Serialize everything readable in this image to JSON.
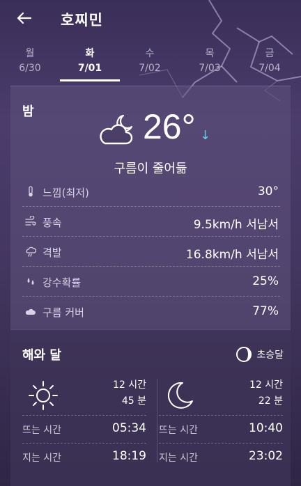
{
  "header": {
    "city": "호찌민",
    "back_icon": "back-arrow-icon"
  },
  "tabs": [
    {
      "dow": "월",
      "date": "6/30",
      "active": false
    },
    {
      "dow": "화",
      "date": "7/01",
      "active": true
    },
    {
      "dow": "수",
      "date": "7/02",
      "active": false
    },
    {
      "dow": "목",
      "date": "7/03",
      "active": false
    },
    {
      "dow": "금",
      "date": "7/04",
      "active": false
    }
  ],
  "detail": {
    "period": "밤",
    "condition_icon": "partly-cloudy-night-icon",
    "temperature": "26°",
    "trend": "↓",
    "condition": "구름이 줄어듦",
    "rows": [
      {
        "icon": "thermometer-icon",
        "label": "느낌(최저)",
        "value": "30°"
      },
      {
        "icon": "wind-icon",
        "label": "풍속",
        "value": "9.5km/h 서남서"
      },
      {
        "icon": "gust-icon",
        "label": "격발",
        "value": "16.8km/h 서남서"
      },
      {
        "icon": "rain-drops-icon",
        "label": "강수확률",
        "value": "25%"
      },
      {
        "icon": "cloud-icon",
        "label": "구름 커버",
        "value": "77%"
      }
    ]
  },
  "sun_moon": {
    "title": "해와 달",
    "moon_phase": "초승달",
    "sun": {
      "duration_hours": "12 시간",
      "duration_minutes": "45 분",
      "rise_label": "뜨는 시간",
      "rise_time": "05:34",
      "set_label": "지는 시간",
      "set_time": "18:19"
    },
    "moon": {
      "duration_hours": "12 시간",
      "duration_minutes": "22 분",
      "rise_label": "뜨는 시간",
      "rise_time": "10:40",
      "set_label": "지는 시간",
      "set_time": "23:02"
    }
  },
  "colors": {
    "accent_trend": "#6fc6e6",
    "background": "#3a2f58"
  }
}
